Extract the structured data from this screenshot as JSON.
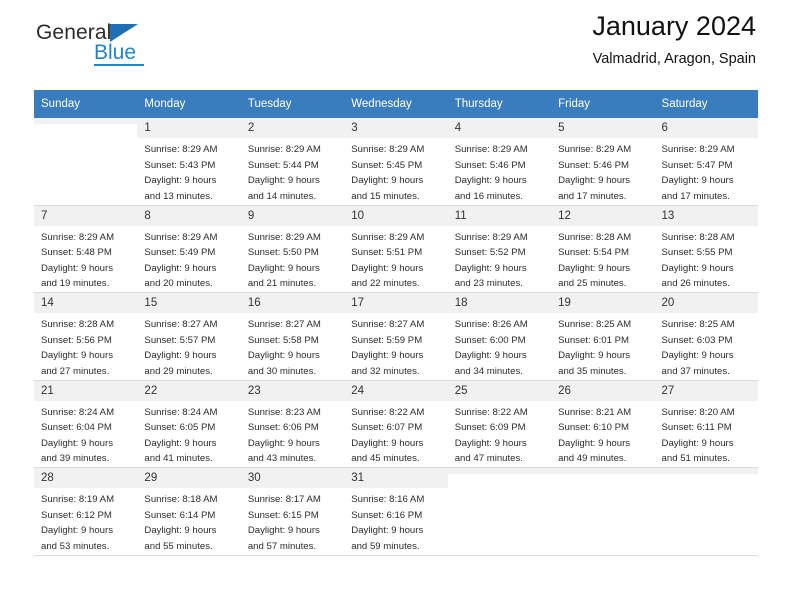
{
  "brand": {
    "name_part1": "General",
    "name_part2": "Blue",
    "triangle_color": "#1f6fb5",
    "blue_color": "#2184d0"
  },
  "header": {
    "title": "January 2024",
    "subtitle": "Valmadrid, Aragon, Spain"
  },
  "colors": {
    "header_row_bg": "#3a7dbf",
    "header_row_text": "#ffffff",
    "daynum_bg": "#f1f1f1",
    "grid_line": "#dcdcdc"
  },
  "calendar": {
    "weekday_headers": [
      "Sunday",
      "Monday",
      "Tuesday",
      "Wednesday",
      "Thursday",
      "Friday",
      "Saturday"
    ],
    "weeks": [
      [
        {
          "day": "",
          "sunrise": "",
          "sunset": "",
          "daylight_line1": "",
          "daylight_line2": "",
          "empty": true
        },
        {
          "day": "1",
          "sunrise": "Sunrise: 8:29 AM",
          "sunset": "Sunset: 5:43 PM",
          "daylight_line1": "Daylight: 9 hours",
          "daylight_line2": "and 13 minutes."
        },
        {
          "day": "2",
          "sunrise": "Sunrise: 8:29 AM",
          "sunset": "Sunset: 5:44 PM",
          "daylight_line1": "Daylight: 9 hours",
          "daylight_line2": "and 14 minutes."
        },
        {
          "day": "3",
          "sunrise": "Sunrise: 8:29 AM",
          "sunset": "Sunset: 5:45 PM",
          "daylight_line1": "Daylight: 9 hours",
          "daylight_line2": "and 15 minutes."
        },
        {
          "day": "4",
          "sunrise": "Sunrise: 8:29 AM",
          "sunset": "Sunset: 5:46 PM",
          "daylight_line1": "Daylight: 9 hours",
          "daylight_line2": "and 16 minutes."
        },
        {
          "day": "5",
          "sunrise": "Sunrise: 8:29 AM",
          "sunset": "Sunset: 5:46 PM",
          "daylight_line1": "Daylight: 9 hours",
          "daylight_line2": "and 17 minutes."
        },
        {
          "day": "6",
          "sunrise": "Sunrise: 8:29 AM",
          "sunset": "Sunset: 5:47 PM",
          "daylight_line1": "Daylight: 9 hours",
          "daylight_line2": "and 17 minutes."
        }
      ],
      [
        {
          "day": "7",
          "sunrise": "Sunrise: 8:29 AM",
          "sunset": "Sunset: 5:48 PM",
          "daylight_line1": "Daylight: 9 hours",
          "daylight_line2": "and 19 minutes."
        },
        {
          "day": "8",
          "sunrise": "Sunrise: 8:29 AM",
          "sunset": "Sunset: 5:49 PM",
          "daylight_line1": "Daylight: 9 hours",
          "daylight_line2": "and 20 minutes."
        },
        {
          "day": "9",
          "sunrise": "Sunrise: 8:29 AM",
          "sunset": "Sunset: 5:50 PM",
          "daylight_line1": "Daylight: 9 hours",
          "daylight_line2": "and 21 minutes."
        },
        {
          "day": "10",
          "sunrise": "Sunrise: 8:29 AM",
          "sunset": "Sunset: 5:51 PM",
          "daylight_line1": "Daylight: 9 hours",
          "daylight_line2": "and 22 minutes."
        },
        {
          "day": "11",
          "sunrise": "Sunrise: 8:29 AM",
          "sunset": "Sunset: 5:52 PM",
          "daylight_line1": "Daylight: 9 hours",
          "daylight_line2": "and 23 minutes."
        },
        {
          "day": "12",
          "sunrise": "Sunrise: 8:28 AM",
          "sunset": "Sunset: 5:54 PM",
          "daylight_line1": "Daylight: 9 hours",
          "daylight_line2": "and 25 minutes."
        },
        {
          "day": "13",
          "sunrise": "Sunrise: 8:28 AM",
          "sunset": "Sunset: 5:55 PM",
          "daylight_line1": "Daylight: 9 hours",
          "daylight_line2": "and 26 minutes."
        }
      ],
      [
        {
          "day": "14",
          "sunrise": "Sunrise: 8:28 AM",
          "sunset": "Sunset: 5:56 PM",
          "daylight_line1": "Daylight: 9 hours",
          "daylight_line2": "and 27 minutes."
        },
        {
          "day": "15",
          "sunrise": "Sunrise: 8:27 AM",
          "sunset": "Sunset: 5:57 PM",
          "daylight_line1": "Daylight: 9 hours",
          "daylight_line2": "and 29 minutes."
        },
        {
          "day": "16",
          "sunrise": "Sunrise: 8:27 AM",
          "sunset": "Sunset: 5:58 PM",
          "daylight_line1": "Daylight: 9 hours",
          "daylight_line2": "and 30 minutes."
        },
        {
          "day": "17",
          "sunrise": "Sunrise: 8:27 AM",
          "sunset": "Sunset: 5:59 PM",
          "daylight_line1": "Daylight: 9 hours",
          "daylight_line2": "and 32 minutes."
        },
        {
          "day": "18",
          "sunrise": "Sunrise: 8:26 AM",
          "sunset": "Sunset: 6:00 PM",
          "daylight_line1": "Daylight: 9 hours",
          "daylight_line2": "and 34 minutes."
        },
        {
          "day": "19",
          "sunrise": "Sunrise: 8:25 AM",
          "sunset": "Sunset: 6:01 PM",
          "daylight_line1": "Daylight: 9 hours",
          "daylight_line2": "and 35 minutes."
        },
        {
          "day": "20",
          "sunrise": "Sunrise: 8:25 AM",
          "sunset": "Sunset: 6:03 PM",
          "daylight_line1": "Daylight: 9 hours",
          "daylight_line2": "and 37 minutes."
        }
      ],
      [
        {
          "day": "21",
          "sunrise": "Sunrise: 8:24 AM",
          "sunset": "Sunset: 6:04 PM",
          "daylight_line1": "Daylight: 9 hours",
          "daylight_line2": "and 39 minutes."
        },
        {
          "day": "22",
          "sunrise": "Sunrise: 8:24 AM",
          "sunset": "Sunset: 6:05 PM",
          "daylight_line1": "Daylight: 9 hours",
          "daylight_line2": "and 41 minutes."
        },
        {
          "day": "23",
          "sunrise": "Sunrise: 8:23 AM",
          "sunset": "Sunset: 6:06 PM",
          "daylight_line1": "Daylight: 9 hours",
          "daylight_line2": "and 43 minutes."
        },
        {
          "day": "24",
          "sunrise": "Sunrise: 8:22 AM",
          "sunset": "Sunset: 6:07 PM",
          "daylight_line1": "Daylight: 9 hours",
          "daylight_line2": "and 45 minutes."
        },
        {
          "day": "25",
          "sunrise": "Sunrise: 8:22 AM",
          "sunset": "Sunset: 6:09 PM",
          "daylight_line1": "Daylight: 9 hours",
          "daylight_line2": "and 47 minutes."
        },
        {
          "day": "26",
          "sunrise": "Sunrise: 8:21 AM",
          "sunset": "Sunset: 6:10 PM",
          "daylight_line1": "Daylight: 9 hours",
          "daylight_line2": "and 49 minutes."
        },
        {
          "day": "27",
          "sunrise": "Sunrise: 8:20 AM",
          "sunset": "Sunset: 6:11 PM",
          "daylight_line1": "Daylight: 9 hours",
          "daylight_line2": "and 51 minutes."
        }
      ],
      [
        {
          "day": "28",
          "sunrise": "Sunrise: 8:19 AM",
          "sunset": "Sunset: 6:12 PM",
          "daylight_line1": "Daylight: 9 hours",
          "daylight_line2": "and 53 minutes."
        },
        {
          "day": "29",
          "sunrise": "Sunrise: 8:18 AM",
          "sunset": "Sunset: 6:14 PM",
          "daylight_line1": "Daylight: 9 hours",
          "daylight_line2": "and 55 minutes."
        },
        {
          "day": "30",
          "sunrise": "Sunrise: 8:17 AM",
          "sunset": "Sunset: 6:15 PM",
          "daylight_line1": "Daylight: 9 hours",
          "daylight_line2": "and 57 minutes."
        },
        {
          "day": "31",
          "sunrise": "Sunrise: 8:16 AM",
          "sunset": "Sunset: 6:16 PM",
          "daylight_line1": "Daylight: 9 hours",
          "daylight_line2": "and 59 minutes."
        },
        {
          "day": "",
          "sunrise": "",
          "sunset": "",
          "daylight_line1": "",
          "daylight_line2": "",
          "empty": true
        },
        {
          "day": "",
          "sunrise": "",
          "sunset": "",
          "daylight_line1": "",
          "daylight_line2": "",
          "empty": true
        },
        {
          "day": "",
          "sunrise": "",
          "sunset": "",
          "daylight_line1": "",
          "daylight_line2": "",
          "empty": true
        }
      ]
    ]
  }
}
